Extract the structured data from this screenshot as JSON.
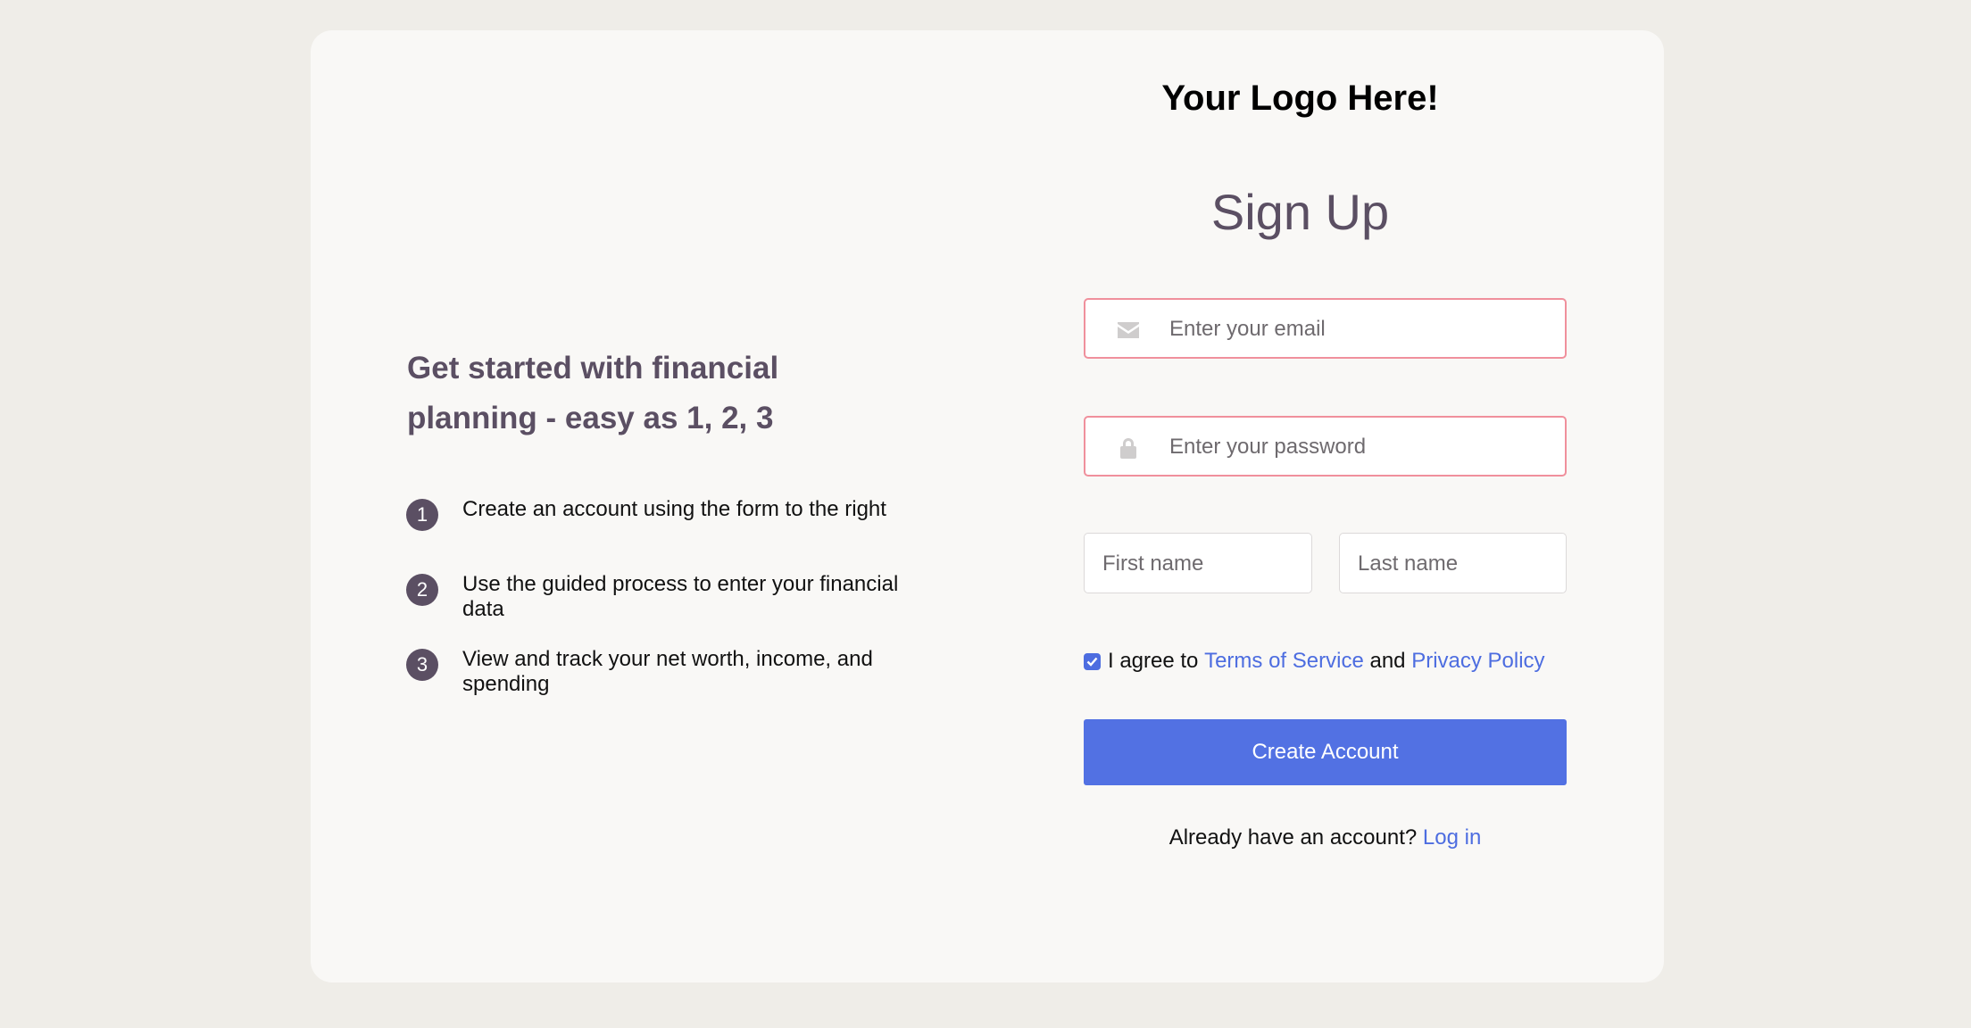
{
  "intro": {
    "heading": "Get started with financial planning - easy as 1, 2, 3",
    "steps": [
      {
        "number": "1",
        "text": "Create an account using the form to the right"
      },
      {
        "number": "2",
        "text": "Use the guided process to enter your financial data"
      },
      {
        "number": "3",
        "text": "View and track your net worth, income, and spending"
      }
    ]
  },
  "form": {
    "logo": "Your Logo Here!",
    "title": "Sign Up",
    "email": {
      "placeholder": "Enter your email",
      "value": "",
      "icon": "envelope-icon"
    },
    "password": {
      "placeholder": "Enter your password",
      "value": "",
      "icon": "lock-icon"
    },
    "first_name": {
      "placeholder": "First name",
      "value": ""
    },
    "last_name": {
      "placeholder": "Last name",
      "value": ""
    },
    "agree": {
      "checked": true,
      "prefix": "I agree to",
      "terms_label": "Terms of Service",
      "conjunction": "and",
      "privacy_label": "Privacy Policy"
    },
    "submit_label": "Create Account",
    "login_prompt": "Already have an account?",
    "login_label": "Log in"
  },
  "colors": {
    "accent": "#5271e3",
    "link": "#4d6de0",
    "heading": "#5b4f63",
    "input_error_border": "#f0909c"
  }
}
